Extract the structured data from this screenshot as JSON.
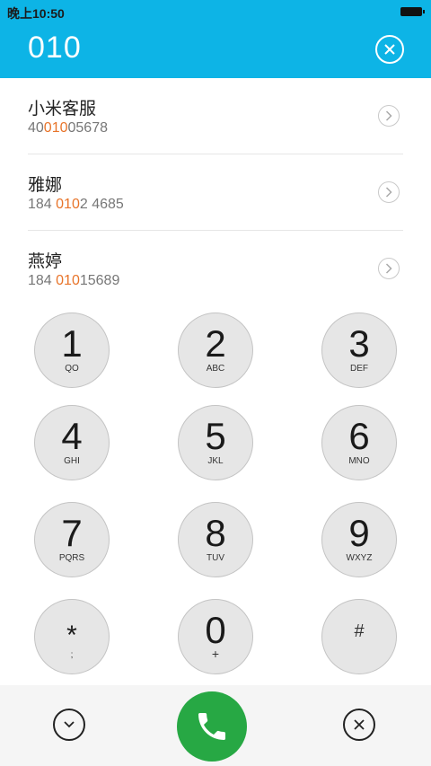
{
  "status_bar": {
    "time": "晚上10:50"
  },
  "header": {
    "dialed_number": "010"
  },
  "results": [
    {
      "name": "小米客服",
      "number_parts": [
        "40",
        "010",
        "05678"
      ]
    },
    {
      "name": "雅娜",
      "number_parts": [
        "184 ",
        "010",
        "2 4685"
      ]
    },
    {
      "name": "燕婷",
      "number_parts": [
        "184 ",
        "010",
        "15689"
      ]
    }
  ],
  "keypad": [
    {
      "digit": "1",
      "letters": "QO"
    },
    {
      "digit": "2",
      "letters": "ABC"
    },
    {
      "digit": "3",
      "letters": "DEF"
    },
    {
      "digit": "4",
      "letters": "GHI"
    },
    {
      "digit": "5",
      "letters": "JKL"
    },
    {
      "digit": "6",
      "letters": "MNO"
    },
    {
      "digit": "7",
      "letters": "PQRS"
    },
    {
      "digit": "8",
      "letters": "TUV"
    },
    {
      "digit": "9",
      "letters": "WXYZ"
    },
    {
      "digit": "*",
      "letters": ";"
    },
    {
      "digit": "0",
      "letters": "+"
    },
    {
      "digit": "#",
      "letters": ""
    }
  ],
  "colors": {
    "accent": "#0db4e6",
    "highlight": "#e8742a",
    "call": "#27a844"
  },
  "icons": {
    "clear": "clear-circle-icon",
    "row": "chevron-right-icon",
    "collapse": "chevron-down-icon",
    "call": "phone-icon",
    "delete": "close-icon"
  }
}
